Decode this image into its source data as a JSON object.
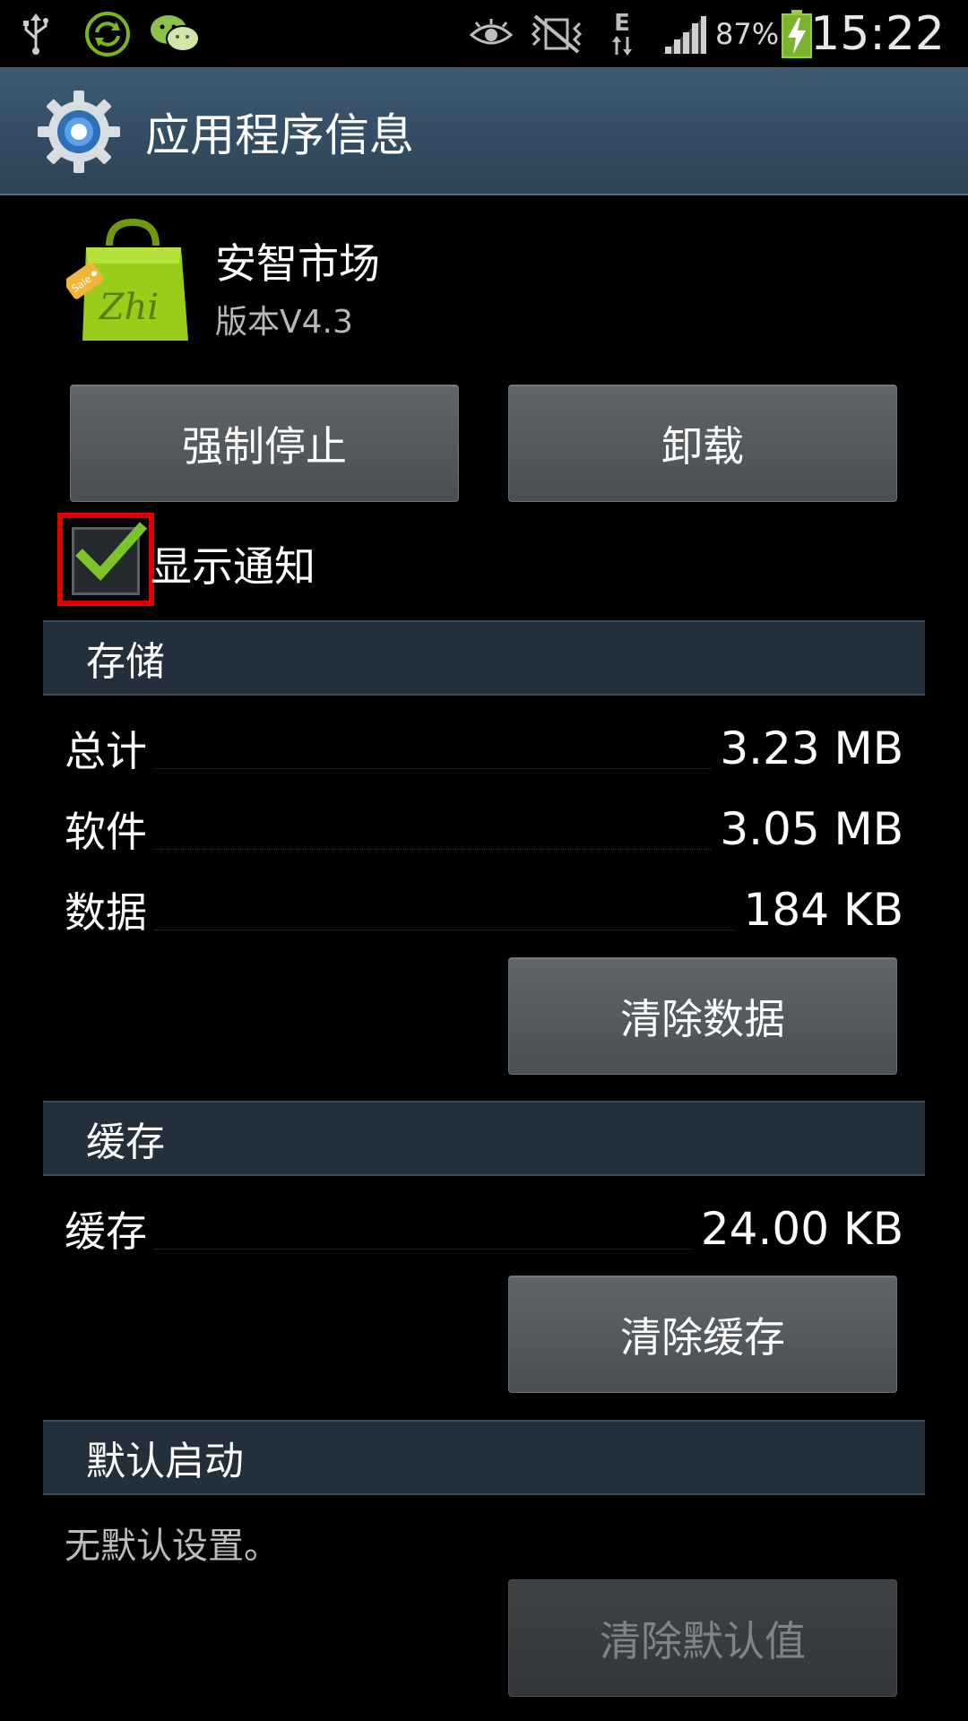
{
  "status_bar": {
    "battery_percent": "87%",
    "time": "15:22",
    "network_type": "E",
    "icons": [
      "usb-icon",
      "sync-icon",
      "wechat-icon",
      "eye-icon",
      "mute-vibrate-icon",
      "data-transfer-icon",
      "signal-icon",
      "battery-charging-icon"
    ]
  },
  "action_bar": {
    "title": "应用程序信息",
    "icon": "settings-gear-icon"
  },
  "app": {
    "name": "安智市场",
    "version": "版本V4.3",
    "icon": "shopping-bag-icon"
  },
  "buttons": {
    "force_stop": "强制停止",
    "uninstall": "卸载",
    "clear_data": "清除数据",
    "clear_cache": "清除缓存",
    "clear_defaults": "清除默认值"
  },
  "notification": {
    "label": "显示通知",
    "checked": true
  },
  "storage": {
    "header": "存储",
    "rows": [
      {
        "label": "总计",
        "value": "3.23 MB"
      },
      {
        "label": "软件",
        "value": "3.05 MB"
      },
      {
        "label": "数据",
        "value": "184 KB"
      }
    ]
  },
  "cache": {
    "header": "缓存",
    "rows": [
      {
        "label": "缓存",
        "value": "24.00 KB"
      }
    ]
  },
  "defaults": {
    "header": "默认启动",
    "note": "无默认设置。"
  },
  "colors": {
    "accent_check": "#7ac52a",
    "highlight_box": "#e00000",
    "action_bar": "#3a5066",
    "section_header": "#23303c"
  }
}
